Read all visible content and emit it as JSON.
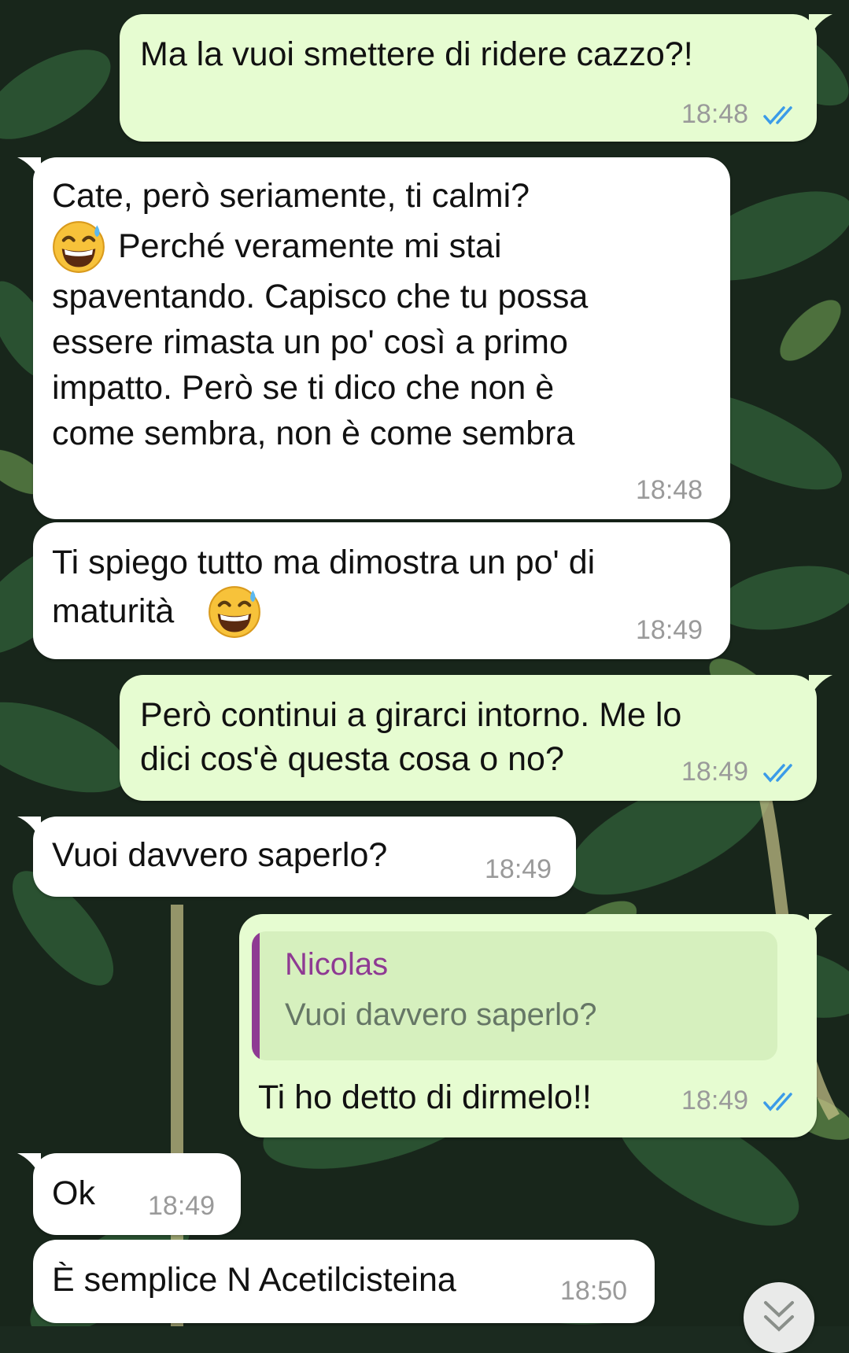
{
  "colors": {
    "incoming_bubble": "#ffffff",
    "outgoing_bubble": "#e6fcd1",
    "read_ticks": "#3b9be8",
    "quote_author": "#8e3a93",
    "timestamp": "#9a9a9a"
  },
  "messages": [
    {
      "direction": "out",
      "text_lines": [
        "Ma la vuoi smettere di ridere cazzo?!"
      ],
      "time": "18:48",
      "status": "read"
    },
    {
      "direction": "in",
      "text_lines": [
        "Cate, però seriamente, ti calmi?",
        "Perché veramente mi stai",
        "spaventando. Capisco che tu possa",
        "essere rimasta un po' così a primo",
        "impatto. Però se ti dico che non è",
        "come sembra, non è come sembra"
      ],
      "time": "18:48",
      "emoji": "grinning-face-with-sweat"
    },
    {
      "direction": "in",
      "text_lines": [
        "Ti spiego tutto ma dimostra un po' di",
        "maturità"
      ],
      "time": "18:49",
      "emoji": "grinning-face-with-sweat"
    },
    {
      "direction": "out",
      "text_lines": [
        "Però continui a girarci intorno. Me lo",
        "dici cos'è questa cosa o no?"
      ],
      "time": "18:49",
      "status": "read"
    },
    {
      "direction": "in",
      "text_lines": [
        "Vuoi davvero saperlo?"
      ],
      "time": "18:49"
    },
    {
      "direction": "out",
      "quote": {
        "author": "Nicolas",
        "text": "Vuoi davvero saperlo?"
      },
      "text_lines": [
        "Ti ho detto di dirmelo!!"
      ],
      "time": "18:49",
      "status": "read"
    },
    {
      "direction": "in",
      "text_lines": [
        "Ok"
      ],
      "time": "18:49"
    },
    {
      "direction": "in",
      "text_lines": [
        "È semplice N Acetilcisteina"
      ],
      "time": "18:50"
    }
  ],
  "scroll_button": {
    "icon": "double-chevron-down-icon"
  }
}
